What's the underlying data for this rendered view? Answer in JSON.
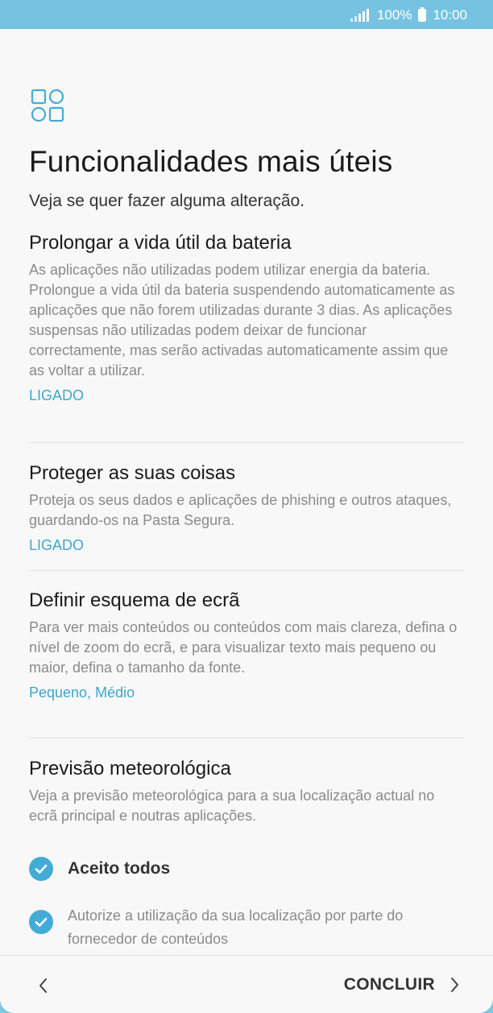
{
  "status_bar": {
    "battery": "100%",
    "time": "10:00",
    "signal_icon": "signal-icon",
    "battery_icon": "battery-icon"
  },
  "header": {
    "icon": "apps-grid-icon",
    "title": "Funcionalidades mais úteis",
    "subtitle": "Veja se quer fazer alguma alteração."
  },
  "sections": [
    {
      "title": "Prolongar a vida útil da bateria",
      "description": "As aplicações não utilizadas podem utilizar energia da bateria. Prolongue a vida útil da bateria suspendendo automaticamente as aplicações que não forem utilizadas durante 3 dias. As aplicações suspensas não utilizadas podem deixar de funcionar correctamente, mas serão activadas automaticamente assim que as voltar a utilizar.",
      "status": "LIGADO"
    },
    {
      "title": "Proteger as suas coisas",
      "description": "Proteja os seus dados e aplicações de phishing e outros ataques, guardando-os na Pasta Segura.",
      "status": "LIGADO"
    },
    {
      "title": "Definir esquema de ecrã",
      "description": "Para ver mais conteúdos ou conteúdos com mais clareza, defina o nível de zoom do ecrã, e para visualizar texto mais pequeno ou maior, defina o tamanho da fonte.",
      "status": "Pequeno, Médio"
    },
    {
      "title": "Previsão meteorológica",
      "description": "Veja a previsão meteorológica para a sua localização actual no ecrã principal e noutras aplicações."
    }
  ],
  "checkboxes": [
    {
      "label": "Aceito todos",
      "checked": true
    },
    {
      "label": "Autorize a utilização da sua localização por parte do fornecedor de conteúdos",
      "checked": true
    }
  ],
  "nav": {
    "back_icon": "chevron-left-icon",
    "next_label": "CONCLUIR",
    "next_icon": "chevron-right-icon"
  },
  "colors": {
    "status_bar": "#75c3e0",
    "accent": "#3ea6cc",
    "checkbox": "#42acd6",
    "background": "#f8f8f8"
  }
}
